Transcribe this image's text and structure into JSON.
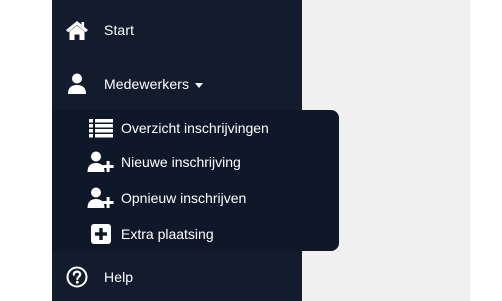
{
  "colors": {
    "sidebar_bg": "#131c2c",
    "submenu_bg": "#0f1828",
    "text": "#ffffff",
    "content_bg": "#f0f0f0"
  },
  "nav": {
    "start": {
      "label": "Start",
      "icon": "home-icon"
    },
    "medewerkers": {
      "label": "Medewerkers",
      "icon": "user-icon",
      "expanded": true
    },
    "help": {
      "label": "Help",
      "icon": "question-circle-icon"
    }
  },
  "submenu": {
    "items": [
      {
        "label": "Overzicht inschrijvingen",
        "icon": "list-icon"
      },
      {
        "label": "Nieuwe inschrijving",
        "icon": "user-plus-icon"
      },
      {
        "label": "Opnieuw inschrijven",
        "icon": "user-plus-icon"
      },
      {
        "label": "Extra plaatsing",
        "icon": "plus-square-icon"
      }
    ]
  }
}
